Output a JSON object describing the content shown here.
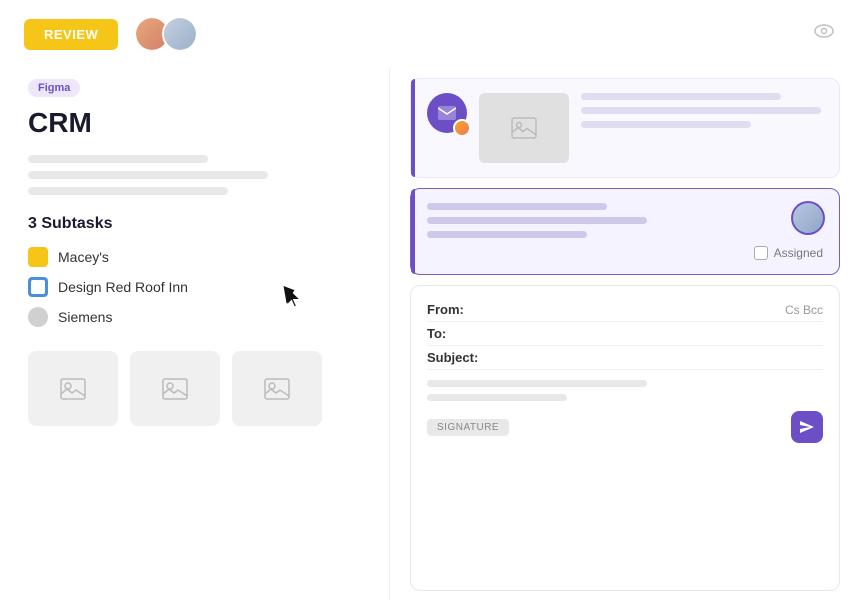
{
  "topbar": {
    "review_label": "REVIEW",
    "eye_label": "👁"
  },
  "left": {
    "figma_badge": "Figma",
    "title": "CRM",
    "subtasks_heading": "3 Subtasks",
    "subtasks": [
      {
        "id": "maceys",
        "label": "Macey's",
        "icon_type": "yellow"
      },
      {
        "id": "design-red-roof",
        "label": "Design Red Roof Inn",
        "icon_type": "blue"
      },
      {
        "id": "siemens",
        "label": "Siemens",
        "icon_type": "gray"
      }
    ],
    "thumbnails": [
      {
        "id": "thumb-1"
      },
      {
        "id": "thumb-2"
      },
      {
        "id": "thumb-3"
      }
    ]
  },
  "right": {
    "card1": {
      "text_lines": [
        "tl-1",
        "tl-2",
        "tl-3"
      ]
    },
    "card2": {
      "assigned_label": "Assigned"
    },
    "email": {
      "from_label": "From:",
      "to_label": "To:",
      "subject_label": "Subject:",
      "cc_label": "Cs Bcc",
      "signature_label": "SIGNATURE"
    }
  },
  "icons": {
    "image_placeholder": "🖼",
    "envelope": "✉",
    "send": "✉"
  }
}
